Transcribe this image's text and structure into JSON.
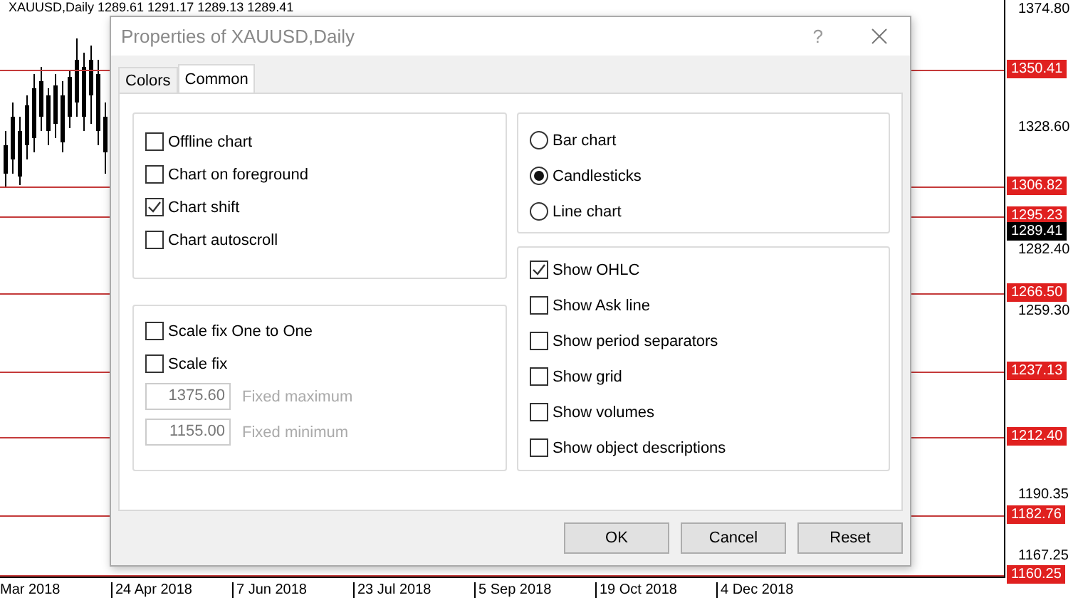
{
  "chart": {
    "header": "XAUUSD,Daily  1289.61 1291.17 1289.13 1289.41",
    "price_axis": [
      {
        "text": "1374.80",
        "kind": "tick"
      },
      {
        "text": "1350.41",
        "kind": "level"
      },
      {
        "text": "1328.60",
        "kind": "tick"
      },
      {
        "text": "1306.82",
        "kind": "level"
      },
      {
        "text": "1295.23",
        "kind": "level"
      },
      {
        "text": "1289.41",
        "kind": "current"
      },
      {
        "text": "1282.40",
        "kind": "tick"
      },
      {
        "text": "1266.50",
        "kind": "level"
      },
      {
        "text": "1259.30",
        "kind": "tick"
      },
      {
        "text": "1237.13",
        "kind": "level"
      },
      {
        "text": "1212.40",
        "kind": "level"
      },
      {
        "text": "1190.35",
        "kind": "tick"
      },
      {
        "text": "1182.76",
        "kind": "level"
      },
      {
        "text": "1167.25",
        "kind": "tick"
      },
      {
        "text": "1160.25",
        "kind": "level"
      }
    ],
    "time_axis": [
      "Mar 2018",
      "24 Apr 2018",
      "7 Jun 2018",
      "23 Jul 2018",
      "5 Sep 2018",
      "19 Oct 2018",
      "4 Dec 2018"
    ]
  },
  "dialog": {
    "title": "Properties of XAUUSD,Daily",
    "help": "?",
    "tabs": [
      {
        "label": "Colors",
        "selected": false
      },
      {
        "label": "Common",
        "selected": true
      }
    ],
    "chart_options": [
      {
        "label": "Offline chart",
        "checked": false
      },
      {
        "label": "Chart on foreground",
        "checked": false
      },
      {
        "label": "Chart shift",
        "checked": true
      },
      {
        "label": "Chart autoscroll",
        "checked": false
      }
    ],
    "scale_options": [
      {
        "label": "Scale fix One to One",
        "checked": false
      },
      {
        "label": "Scale fix",
        "checked": false
      }
    ],
    "scale_fields": [
      {
        "value": "1375.60",
        "label": "Fixed maximum",
        "disabled": true
      },
      {
        "value": "1155.00",
        "label": "Fixed minimum",
        "disabled": true
      }
    ],
    "chart_types": [
      {
        "label": "Bar chart",
        "selected": false
      },
      {
        "label": "Candlesticks",
        "selected": true
      },
      {
        "label": "Line chart",
        "selected": false
      }
    ],
    "show_options": [
      {
        "label": "Show OHLC",
        "checked": true
      },
      {
        "label": "Show Ask line",
        "checked": false
      },
      {
        "label": "Show period separators",
        "checked": false
      },
      {
        "label": "Show grid",
        "checked": false
      },
      {
        "label": "Show volumes",
        "checked": false
      },
      {
        "label": "Show object descriptions",
        "checked": false
      }
    ],
    "buttons": [
      "OK",
      "Cancel",
      "Reset"
    ]
  }
}
